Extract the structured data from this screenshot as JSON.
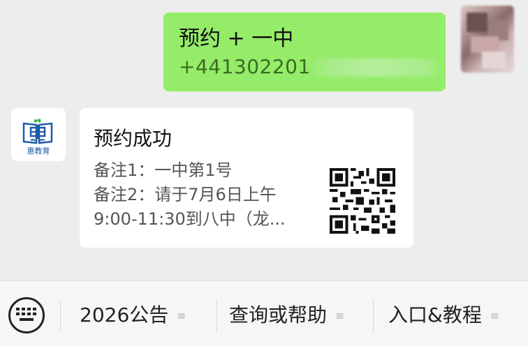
{
  "outgoing_message": {
    "line1": "预约 + 一中",
    "line2": "+441302201"
  },
  "bot": {
    "logo_text": "惠教育",
    "card": {
      "title": "预约成功",
      "notes": [
        "备注1：一中第1号",
        "备注2：请于7月6日上午",
        "9:00-11:30到八中（龙..."
      ]
    }
  },
  "menu": {
    "items": [
      {
        "label": "2026公告"
      },
      {
        "label": "查询或帮助"
      },
      {
        "label": "入口&教程"
      }
    ],
    "grip": "≡"
  },
  "colors": {
    "outgoing_bubble": "#95ec69",
    "chat_background": "#ededed",
    "brand_blue": "#1d5aa8",
    "brand_green": "#3bb34a"
  }
}
